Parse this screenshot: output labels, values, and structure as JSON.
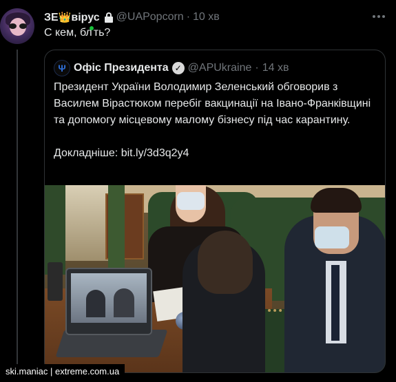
{
  "tweet": {
    "display_name": "ЗЕ",
    "display_name_suffix": "вірус",
    "crown_emoji": "👑",
    "handle": "@UAPopcorn",
    "separator": "·",
    "time": "10 хв",
    "text": "С кем, бл",
    "text_end": "ть?",
    "more_icon": "more-horizontal-icon",
    "lock_icon": "lock-icon"
  },
  "quote": {
    "display_name": "Офіс Президента",
    "handle": "@APUkraine",
    "separator": "·",
    "time": "14 хв",
    "avatar_icon": "trident-icon",
    "avatar_glyph": "Ψ",
    "verified_icon": "verified-badge-icon",
    "verified_glyph": "✓",
    "body": "Президент України Володимир Зеленський обговорив з Василем Вірастюком перебіг вакцинації на Івано-Франківщині та допомогу місцевому малому бізнесу під час карантину.",
    "more_label": "Докладніше: ",
    "link": "bit.ly/3d3q2y4",
    "image": "meeting-photo"
  },
  "watermark": "ski.maniac | extreme.com.ua",
  "colors": {
    "background": "#000000",
    "text": "#e7e9ea",
    "muted": "#71767b",
    "border": "#2f3336",
    "crown": "#f5b800",
    "green_dot": "#18c23a"
  }
}
